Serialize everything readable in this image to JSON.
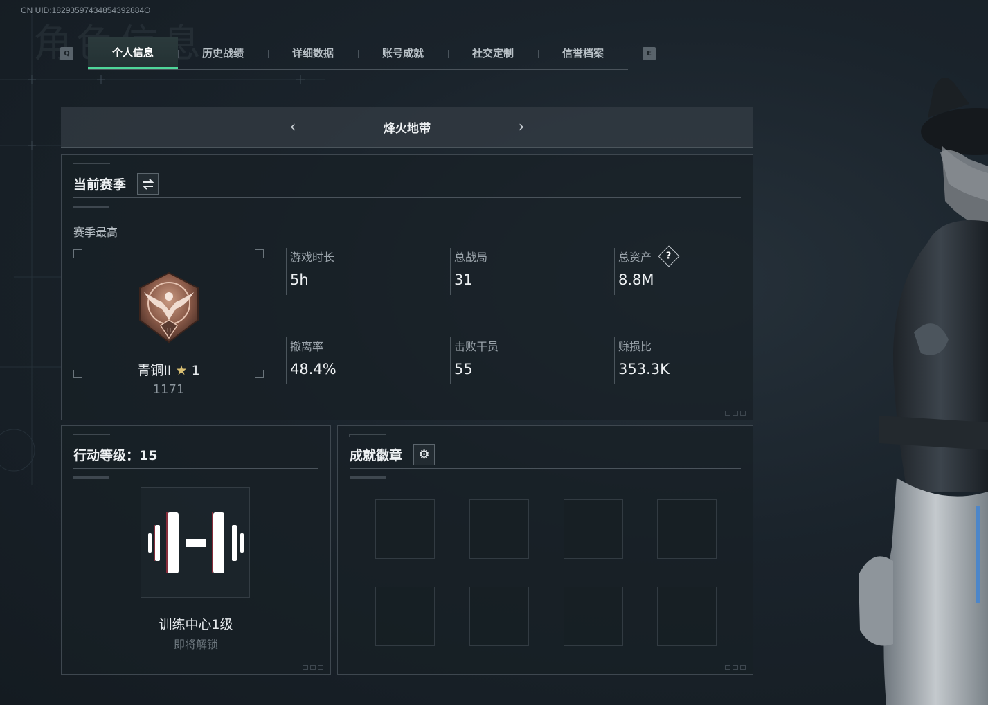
{
  "uid": "CN UID:18293597434854392884O",
  "background_title": "角色信息",
  "keys": {
    "left": "Q",
    "right": "E"
  },
  "tabs": [
    {
      "label": "个人信息",
      "active": true
    },
    {
      "label": "历史战绩",
      "active": false
    },
    {
      "label": "详细数据",
      "active": false
    },
    {
      "label": "账号成就",
      "active": false
    },
    {
      "label": "社交定制",
      "active": false
    },
    {
      "label": "信誉档案",
      "active": false
    }
  ],
  "mode_selector": {
    "mode": "烽火地带",
    "prev_icon": "chevron-left-icon",
    "next_icon": "chevron-right-icon"
  },
  "season_panel": {
    "title": "当前赛季",
    "toggle_icon": "switch-icon",
    "subtitle": "赛季最高",
    "rank": {
      "name": "青铜II",
      "star_icon": "star-icon",
      "stars": "1",
      "score": "1171"
    },
    "stats": [
      {
        "label": "游戏时长",
        "value": "5h"
      },
      {
        "label": "总战局",
        "value": "31"
      },
      {
        "label": "总资产",
        "value": "8.8M",
        "help": "?"
      },
      {
        "label": "撤离率",
        "value": "48.4%"
      },
      {
        "label": "击败干员",
        "value": "55"
      },
      {
        "label": "赚损比",
        "value": "353.3K"
      }
    ]
  },
  "level_panel": {
    "title": "行动等级：15",
    "emblem_icon": "dumbbell-icon",
    "name": "训练中心1级",
    "status": "即将解锁"
  },
  "badge_panel": {
    "title": "成就徽章",
    "settings_icon": "gear-icon",
    "slots": 8
  },
  "colors": {
    "accent": "#4fd79a",
    "text": "#eef1f3",
    "muted": "#9aa3aa",
    "panel_border": "#3e474f"
  }
}
